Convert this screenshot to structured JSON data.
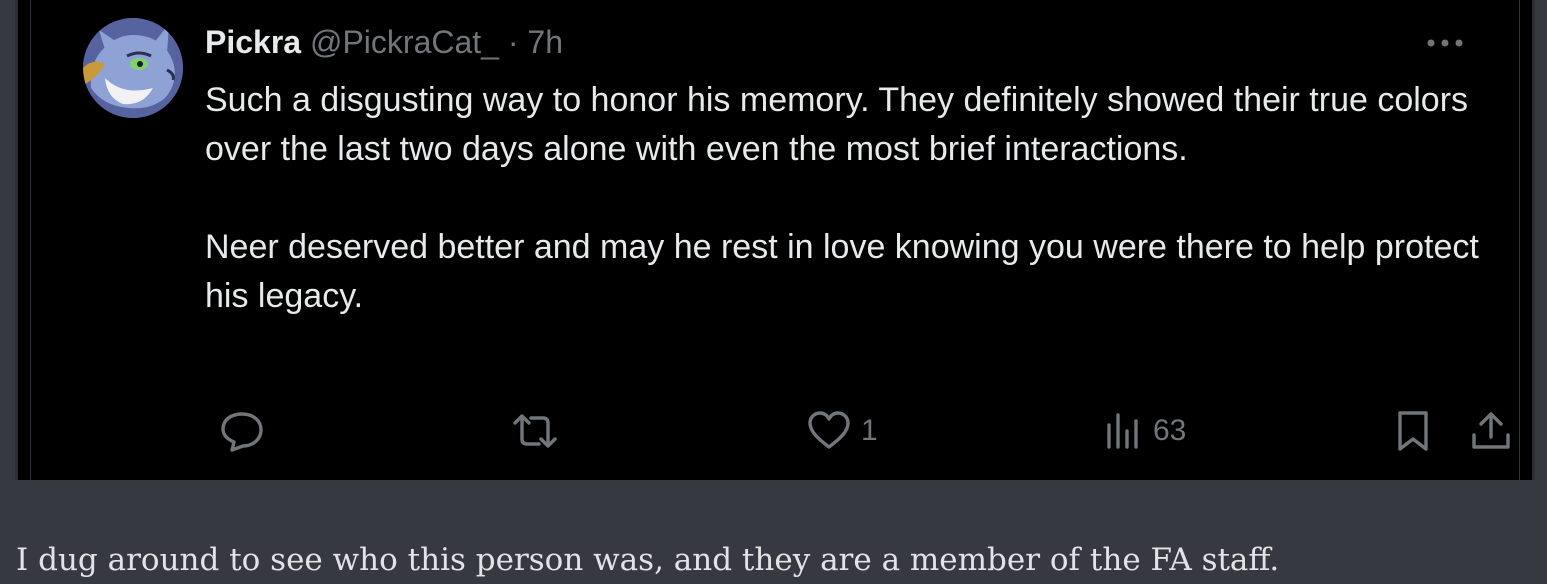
{
  "tweet": {
    "author_name": "Pickra",
    "handle": "@PickraCat_",
    "separator": "·",
    "time": "7h",
    "paragraphs": [
      "Such a disgusting way to honor his memory. They definitely showed their true colors over the last two days alone with even the most brief interactions.",
      "Neer deserved better and may he rest in love knowing you were there to help protect his legacy."
    ],
    "actions": {
      "reply": {
        "icon": "reply-icon",
        "count": ""
      },
      "repost": {
        "icon": "repost-icon",
        "count": ""
      },
      "like": {
        "icon": "heart-icon",
        "count": "1"
      },
      "views": {
        "icon": "views-icon",
        "count": "63"
      },
      "bookmark": {
        "icon": "bookmark-icon"
      },
      "share": {
        "icon": "share-icon"
      }
    },
    "more_icon": "more-icon",
    "avatar_icon": "avatar-icon"
  },
  "caption": "I dug around to see who this person was, and they are a member of the FA staff.",
  "colors": {
    "page_background": "#373940",
    "tweet_background": "#000000",
    "primary_text": "#e7e9ea",
    "secondary_text": "#71767b"
  }
}
